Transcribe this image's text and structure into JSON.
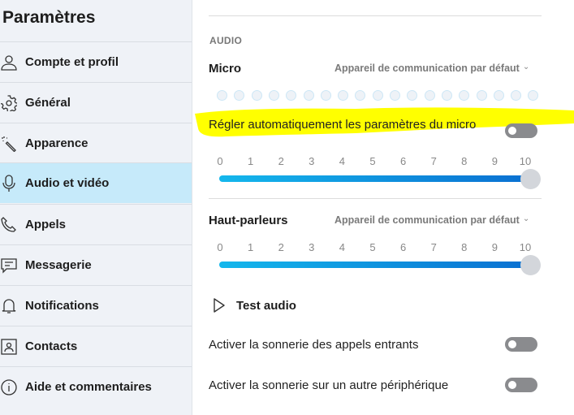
{
  "sidebar": {
    "title": "Paramètres",
    "selected": "Audio et vidéo",
    "items": [
      {
        "label": "Compte et profil",
        "icon": "person-icon"
      },
      {
        "label": "Général",
        "icon": "gear-icon"
      },
      {
        "label": "Apparence",
        "icon": "magic-wand-icon"
      },
      {
        "label": "Audio et vidéo",
        "icon": "microphone-icon"
      },
      {
        "label": "Appels",
        "icon": "phone-icon"
      },
      {
        "label": "Messagerie",
        "icon": "chat-icon"
      },
      {
        "label": "Notifications",
        "icon": "bell-icon"
      },
      {
        "label": "Contacts",
        "icon": "contact-card-icon"
      },
      {
        "label": "Aide et commentaires",
        "icon": "info-icon"
      }
    ]
  },
  "audio": {
    "section": "AUDIO",
    "micro": {
      "label": "Micro",
      "device": "Appareil de communication par défaut",
      "level_dots": 19,
      "level_active": 0
    },
    "auto_adjust": {
      "label": "Régler automatiquement les paramètres du micro",
      "on": false,
      "highlight_color": "#ffff00"
    },
    "micro_volume": {
      "ticks": [
        "0",
        "1",
        "2",
        "3",
        "4",
        "5",
        "6",
        "7",
        "8",
        "9",
        "10"
      ],
      "value": 10
    },
    "speakers": {
      "label": "Haut-parleurs",
      "device": "Appareil de communication par défaut"
    },
    "speaker_volume": {
      "ticks": [
        "0",
        "1",
        "2",
        "3",
        "4",
        "5",
        "6",
        "7",
        "8",
        "9",
        "10"
      ],
      "value": 10
    },
    "test_audio": "Test audio",
    "ring_incoming": {
      "label": "Activer la sonnerie des appels entrants",
      "on": false
    },
    "ring_other": {
      "label": "Activer la sonnerie sur un autre périphérique",
      "on": false
    }
  },
  "colors": {
    "accent_start": "#14b7ec",
    "accent_end": "#0a6fd1",
    "selected_bg": "#c6eafa",
    "toggle_off": "#8a8b8e"
  }
}
